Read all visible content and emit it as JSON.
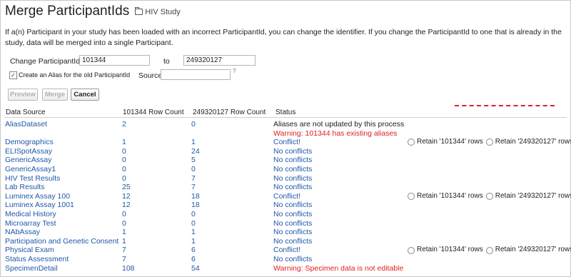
{
  "page": {
    "title": "Merge ParticipantIds",
    "breadcrumb": "HIV Study",
    "intro": "If a(n) Participant in your study has been loaded with an incorrect ParticipantId, you can change the identifier. If you change the ParticipantId to one that is already in the study, data will be merged into a single Participant."
  },
  "form": {
    "change_label": "Change ParticipantId",
    "from_value": "101344",
    "to_label": "to",
    "to_value": "249320127",
    "alias_label": "Create an Alias for the old ParticipantId",
    "alias_checked": true,
    "source_label": "Source",
    "source_value": "",
    "help_mark": "?"
  },
  "buttons": {
    "preview": "Preview",
    "merge": "Merge",
    "cancel": "Cancel"
  },
  "table": {
    "headers": {
      "source": "Data Source",
      "from_count": "101344 Row Count",
      "to_count": "249320127 Row Count",
      "status": "Status"
    },
    "retain_from": "Retain '101344' rows",
    "retain_to": "Retain '249320127' rows",
    "rows": [
      {
        "source": "AliasDataset",
        "a": "2",
        "b": "0",
        "status": "Aliases are not updated by this process",
        "status2": "Warning: 101344 has existing aliases",
        "kind": "alias"
      },
      {
        "source": "Demographics",
        "a": "1",
        "b": "1",
        "status": "Conflict!",
        "kind": "conflict"
      },
      {
        "source": "ELISpotAssay",
        "a": "0",
        "b": "24",
        "status": "No conflicts",
        "kind": "ok"
      },
      {
        "source": "GenericAssay",
        "a": "0",
        "b": "5",
        "status": "No conflicts",
        "kind": "ok"
      },
      {
        "source": "GenericAssay1",
        "a": "0",
        "b": "0",
        "status": "No conflicts",
        "kind": "ok"
      },
      {
        "source": "HIV Test Results",
        "a": "0",
        "b": "7",
        "status": "No conflicts",
        "kind": "ok"
      },
      {
        "source": "Lab Results",
        "a": "25",
        "b": "7",
        "status": "No conflicts",
        "kind": "ok"
      },
      {
        "source": "Luminex Assay 100",
        "a": "12",
        "b": "18",
        "status": "Conflict!",
        "kind": "conflict"
      },
      {
        "source": "Luminex Assay 1001",
        "a": "12",
        "b": "18",
        "status": "No conflicts",
        "kind": "ok"
      },
      {
        "source": "Medical History",
        "a": "0",
        "b": "0",
        "status": "No conflicts",
        "kind": "ok"
      },
      {
        "source": "Microarray Test",
        "a": "0",
        "b": "0",
        "status": "No conflicts",
        "kind": "ok"
      },
      {
        "source": "NAbAssay",
        "a": "1",
        "b": "1",
        "status": "No conflicts",
        "kind": "ok"
      },
      {
        "source": "Participation and Genetic Consent",
        "a": "1",
        "b": "1",
        "status": "No conflicts",
        "kind": "ok"
      },
      {
        "source": "Physical Exam",
        "a": "7",
        "b": "6",
        "status": "Conflict!",
        "kind": "conflict"
      },
      {
        "source": "Status Assessment",
        "a": "7",
        "b": "6",
        "status": "No conflicts",
        "kind": "ok"
      },
      {
        "source": "SpecimenDetail",
        "a": "108",
        "b": "54",
        "status": "Warning: Specimen data is not editable",
        "kind": "warn"
      }
    ]
  }
}
